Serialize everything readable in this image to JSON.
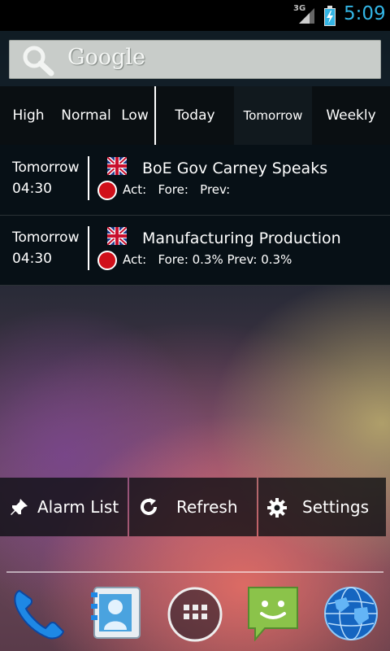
{
  "status_bar": {
    "network": "3G",
    "clock": "5:09",
    "clock_color": "#33b5e5"
  },
  "search": {
    "logo": "Google",
    "icon": "search-icon"
  },
  "tabs": {
    "high": "High",
    "normal": "Normal",
    "low": "Low",
    "today": "Today",
    "tomorrow": "Tomorrow",
    "weekly": "Weekly"
  },
  "events": [
    {
      "day": "Tomorrow",
      "time": "04:30",
      "title": "BoE Gov Carney Speaks",
      "stats": "Act:   Fore:   Prev:",
      "flag": "uk-flag-icon",
      "impact_color": "#d0101a"
    },
    {
      "day": "Tomorrow",
      "time": "04:30",
      "title": "Manufacturing Production",
      "stats": "Act:   Fore: 0.3% Prev: 0.3%",
      "flag": "uk-flag-icon",
      "impact_color": "#d0101a"
    }
  ],
  "actions": {
    "alarm_list": "Alarm List",
    "refresh": "Refresh",
    "settings": "Settings"
  },
  "dock": {
    "icons": [
      "phone-icon",
      "contacts-icon",
      "app-drawer-icon",
      "messaging-icon",
      "browser-icon"
    ]
  }
}
